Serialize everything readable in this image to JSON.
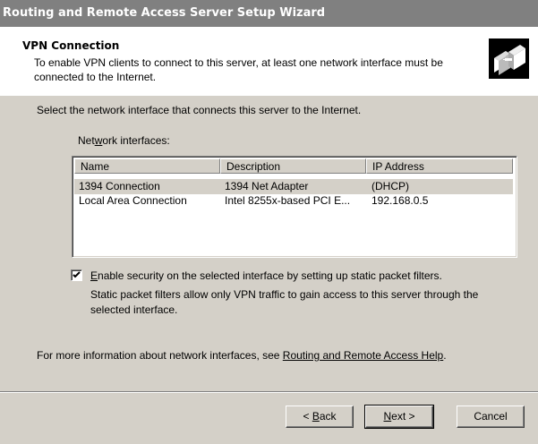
{
  "window": {
    "title": "Routing and Remote Access Server Setup Wizard"
  },
  "header": {
    "title": "VPN Connection",
    "description": "To enable VPN clients to connect to this server, at least one network interface must be connected to the Internet.",
    "icon": "network-connection-icon"
  },
  "body": {
    "instruction": "Select the network interface that connects this server to the Internet.",
    "list_label_pre": "Net",
    "list_label_accel": "w",
    "list_label_post": "ork interfaces:",
    "columns": {
      "name": "Name",
      "description": "Description",
      "ip": "IP Address"
    },
    "rows": [
      {
        "name": "1394 Connection",
        "description": "1394 Net Adapter",
        "ip": "(DHCP)"
      },
      {
        "name": "Local Area Connection",
        "description": "Intel 8255x-based PCI E...",
        "ip": "192.168.0.5"
      }
    ],
    "selected_row": 0,
    "checkbox": {
      "checked": true,
      "label_accel": "E",
      "label_rest": "nable security on the selected interface by setting up static packet filters.",
      "help_line1": "Static packet filters allow only VPN traffic to gain access to this server through the",
      "help_line2": "selected interface."
    },
    "more_info_prefix": "For more information about network interfaces, see ",
    "more_info_link": "Routing and Remote Access Help",
    "more_info_suffix": "."
  },
  "buttons": {
    "back_pre": "< ",
    "back_accel": "B",
    "back_post": "ack",
    "next_accel": "N",
    "next_post": "ext >",
    "cancel": "Cancel"
  }
}
